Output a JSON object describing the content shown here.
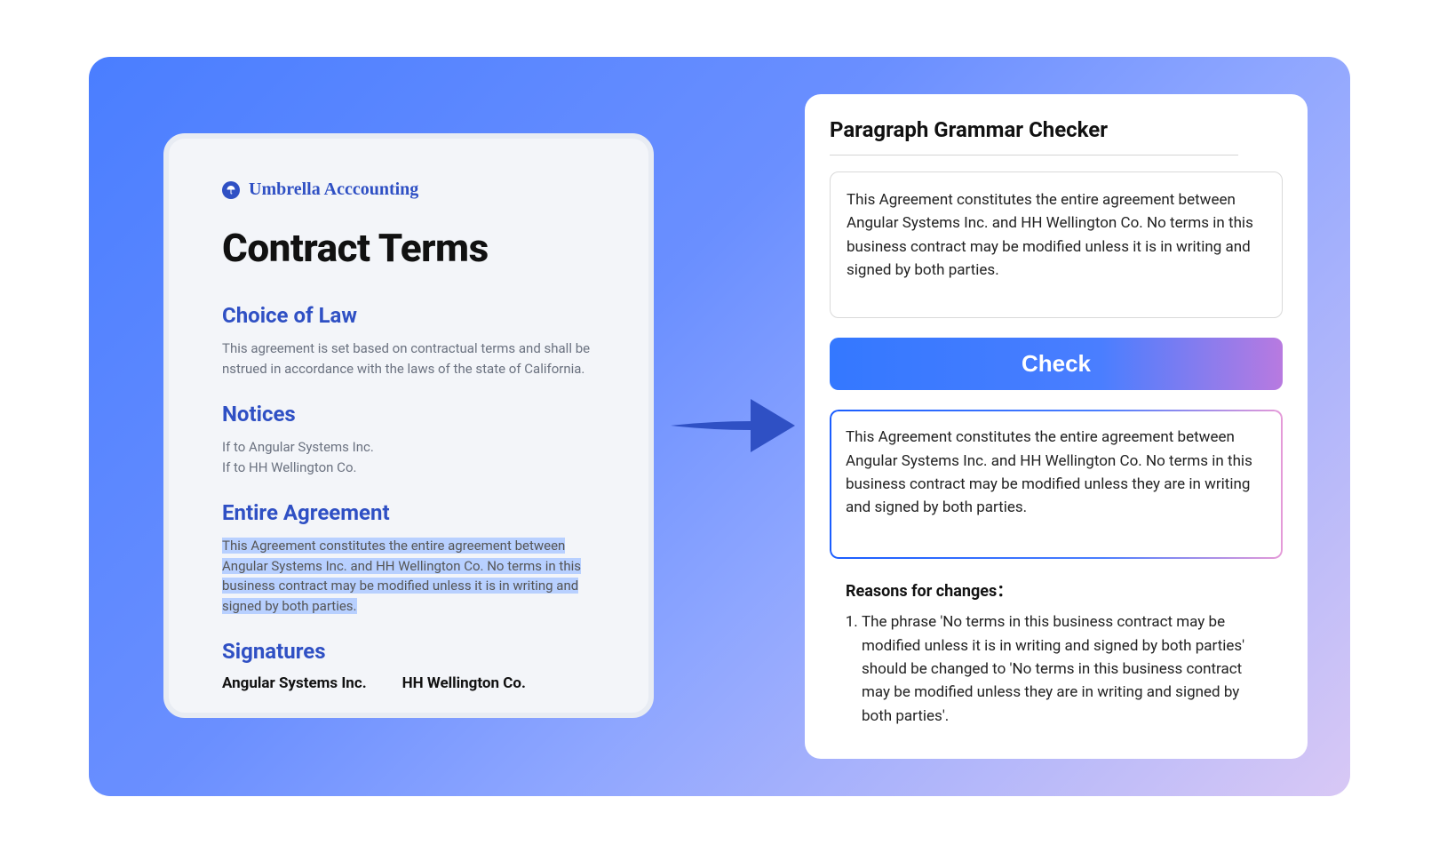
{
  "left": {
    "brand": "Umbrella Acccounting",
    "title": "Contract Terms",
    "sections": {
      "choice": {
        "heading": "Choice of Law",
        "body": "This agreement is set based on contractual terms and shall be nstrued in accordance with the laws of the state of California."
      },
      "notices": {
        "heading": "Notices",
        "line1": "If to Angular Systems Inc.",
        "line2": "If to HH Wellington Co."
      },
      "entire": {
        "heading": "Entire Agreement",
        "body": "This Agreement constitutes the entire agreement between Angular Systems Inc. and HH Wellington Co. No terms in this business contract may be modified unless it is in writing and signed by both parties."
      },
      "signatures": {
        "heading": "Signatures",
        "sig1": "Angular Systems Inc.",
        "sig2": "HH Wellington Co."
      }
    }
  },
  "right": {
    "title": "Paragraph Grammar Checker",
    "input_text": "This Agreement constitutes the entire agreement between Angular Systems Inc. and HH Wellington Co. No terms in this business contract may be modified unless it is in writing and signed by both parties.",
    "check_label": "Check",
    "output_text": "This Agreement constitutes the entire agreement between Angular Systems Inc. and HH Wellington Co. No terms in this business contract may be modified unless they are in writing and signed by both parties.",
    "reasons_label": "Reasons for changes：",
    "reasons": [
      "The phrase 'No terms in this business contract may be modified unless it is in writing and signed by both parties' should be changed to 'No terms in this business contract may be modified unless they are in writing and signed by both parties'."
    ]
  }
}
